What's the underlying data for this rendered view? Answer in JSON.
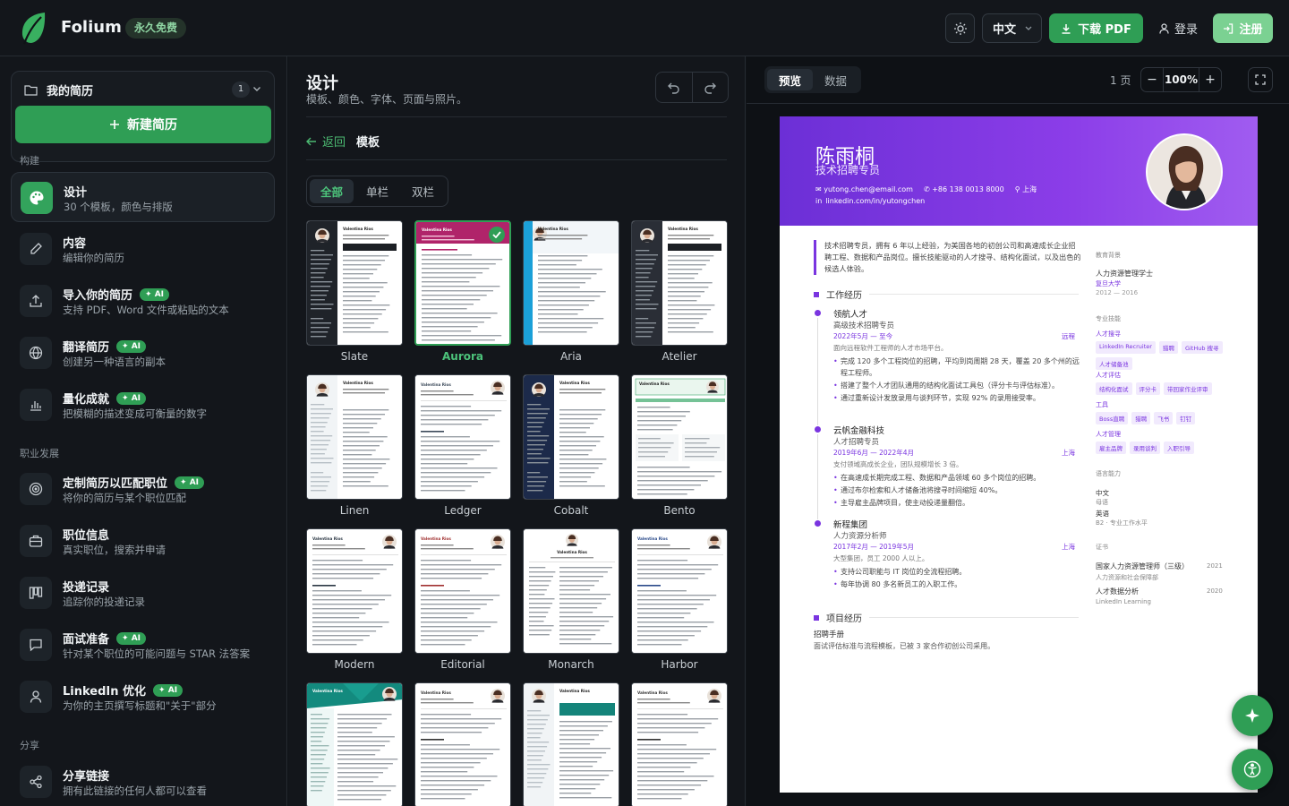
{
  "app": {
    "brand": "Folium",
    "free_badge": "永久免费"
  },
  "topbar": {
    "language": "中文",
    "download_pdf": "下载 PDF",
    "login": "登录",
    "register": "注册"
  },
  "sidebar": {
    "my_resumes": "我的简历",
    "resume_count": "1",
    "new_resume": "新建简历",
    "sections": [
      "构建",
      "职业发展",
      "分享"
    ],
    "ai_label": "AI",
    "items": [
      {
        "title": "设计",
        "sub": "30 个模板，颜色与排版",
        "icon": "palette-icon",
        "ai": false,
        "active": true
      },
      {
        "title": "内容",
        "sub": "编辑你的简历",
        "icon": "pencil-icon",
        "ai": false
      },
      {
        "title": "导入你的简历",
        "sub": "支持 PDF、Word 文件或粘贴的文本",
        "icon": "upload-icon",
        "ai": true
      },
      {
        "title": "翻译简历",
        "sub": "创建另一种语言的副本",
        "icon": "globe-icon",
        "ai": true
      },
      {
        "title": "量化成就",
        "sub": "把模糊的描述变成可衡量的数字",
        "icon": "bar-chart-icon",
        "ai": true
      },
      {
        "title": "定制简历以匹配职位",
        "sub": "将你的简历与某个职位匹配",
        "icon": "target-icon",
        "ai": true
      },
      {
        "title": "职位信息",
        "sub": "真实职位，搜索并申请",
        "icon": "briefcase-icon",
        "ai": false
      },
      {
        "title": "投递记录",
        "sub": "追踪你的投递记录",
        "icon": "kanban-icon",
        "ai": false
      },
      {
        "title": "面试准备",
        "sub": "针对某个职位的可能问题与 STAR 法答案",
        "icon": "chat-icon",
        "ai": true
      },
      {
        "title": "LinkedIn 优化",
        "sub": "为你的主页撰写标题和\"关于\"部分",
        "icon": "user-icon",
        "ai": true
      },
      {
        "title": "分享链接",
        "sub": "拥有此链接的任何人都可以查看",
        "icon": "share-icon",
        "ai": false
      }
    ]
  },
  "design": {
    "title": "设计",
    "subtitle": "模板、颜色、字体、页面与照片。",
    "back": "返回",
    "crumb": "模板",
    "filters": [
      "全部",
      "单栏",
      "双栏"
    ],
    "active_filter": "全部",
    "templates": [
      {
        "name": "Slate",
        "style": "dark-side",
        "accent": "#1f2329",
        "selected": false
      },
      {
        "name": "Aurora",
        "style": "head",
        "accent": "#b0246a",
        "selected": true
      },
      {
        "name": "Aria",
        "style": "blue-side",
        "accent": "#1ba0d8",
        "selected": false
      },
      {
        "name": "Atelier",
        "style": "dark-side",
        "accent": "#2a2e36",
        "selected": false
      },
      {
        "name": "Linen",
        "style": "light-side",
        "accent": "#6a8fa8",
        "selected": false
      },
      {
        "name": "Ledger",
        "style": "plain-right",
        "accent": "#3c4a5a",
        "selected": false
      },
      {
        "name": "Cobalt",
        "style": "navy-side",
        "accent": "#1c2a4a",
        "selected": false
      },
      {
        "name": "Bento",
        "style": "boxed",
        "accent": "#3aa86a",
        "selected": false
      },
      {
        "name": "Modern",
        "style": "plain-right",
        "accent": "#2b3744",
        "selected": false
      },
      {
        "name": "Editorial",
        "style": "plain-right",
        "accent": "#a03030",
        "selected": false
      },
      {
        "name": "Monarch",
        "style": "centered",
        "accent": "#444",
        "selected": false
      },
      {
        "name": "Harbor",
        "style": "plain-right",
        "accent": "#2a4a8a",
        "selected": false
      },
      {
        "name": "",
        "style": "teal-head",
        "accent": "#138a7e",
        "selected": false
      },
      {
        "name": "",
        "style": "plain-right",
        "accent": "#333",
        "selected": false
      },
      {
        "name": "",
        "style": "teal-box",
        "accent": "#14847a",
        "selected": false
      },
      {
        "name": "",
        "style": "plain-right",
        "accent": "#333",
        "selected": false
      }
    ],
    "thumb_name": "Valentina Rios"
  },
  "preview": {
    "tabs": [
      "预览",
      "数据"
    ],
    "active_tab": "预览",
    "pages": "1 页",
    "zoom": "100%",
    "resume": {
      "name": "陈雨桐",
      "title": "技术招聘专员",
      "email": "yutong.chen@email.com",
      "phone": "+86 138 0013 8000",
      "location": "上海",
      "linkedin": "linkedin.com/in/yutongchen",
      "summary": "技术招聘专员，拥有 6 年以上经验，为美国各地的初创公司和高速成长企业招聘工程、数据和产品岗位。擅长技能驱动的人才搜寻、结构化面试，以及出色的候选人体验。",
      "work_title": "工作经历",
      "jobs": [
        {
          "company": "领航人才",
          "role": "高级技术招聘专员",
          "date": "2022年5月 — 至今",
          "location": "远程",
          "desc": "面向远程软件工程师的人才市场平台。",
          "bullets": [
            "完成 120 多个工程岗位的招聘，平均到岗周期 28 天，覆盖 20 多个州的远程工程师。",
            "搭建了整个人才团队通用的结构化面试工具包（评分卡与评估标准）。",
            "通过重新设计发放录用与谈判环节，实现 92% 的录用接受率。"
          ]
        },
        {
          "company": "云帆金融科技",
          "role": "人才招聘专员",
          "date": "2019年6月 — 2022年4月",
          "location": "上海",
          "desc": "支付领域高成长企业，团队规模增长 3 倍。",
          "bullets": [
            "在高速成长期完成工程、数据和产品领域 60 多个岗位的招聘。",
            "通过布尔检索和人才储备池将搜寻时间缩短 40%。",
            "主导雇主品牌项目，使主动投递量翻倍。"
          ]
        },
        {
          "company": "新程集团",
          "role": "人力资源分析师",
          "date": "2017年2月 — 2019年5月",
          "location": "上海",
          "desc": "大型集团，员工 2000 人以上。",
          "bullets": [
            "支持公司职能与 IT 岗位的全流程招聘。",
            "每年协调 80 多名新员工的入职工作。"
          ]
        }
      ],
      "project_title": "项目经历",
      "project_name": "招聘手册",
      "project_desc": "面试评估标准与流程模板，已被 3 家合作初创公司采用。",
      "side": {
        "edu_label": "教育背景",
        "edu_degree": "人力资源管理学士",
        "edu_school": "复旦大学",
        "edu_years": "2012 — 2016",
        "skills_label": "专业技能",
        "skill_groups": [
          {
            "name": "人才搜寻",
            "tags": [
              "LinkedIn Recruiter",
              "猎聘",
              "GitHub 搜寻",
              "人才储备池"
            ]
          },
          {
            "name": "人才评估",
            "tags": [
              "结构化面试",
              "评分卡",
              "带回家作业评审"
            ]
          },
          {
            "name": "工具",
            "tags": [
              "Boss直聘",
              "猎聘",
              "飞书",
              "钉钉"
            ]
          },
          {
            "name": "人才管理",
            "tags": [
              "雇主品牌",
              "录用谈判",
              "入职引导"
            ]
          }
        ],
        "lang_label": "语言能力",
        "langs": [
          {
            "name": "中文",
            "level": "母语"
          },
          {
            "name": "英语",
            "level": "B2 · 专业工作水平"
          }
        ],
        "cert_label": "证书",
        "certs": [
          {
            "name": "国家人力资源管理师（三级）",
            "issuer": "人力资源和社会保障部",
            "year": "2021"
          },
          {
            "name": "人才数据分析",
            "issuer": "LinkedIn Learning",
            "year": "2020"
          }
        ]
      }
    }
  }
}
